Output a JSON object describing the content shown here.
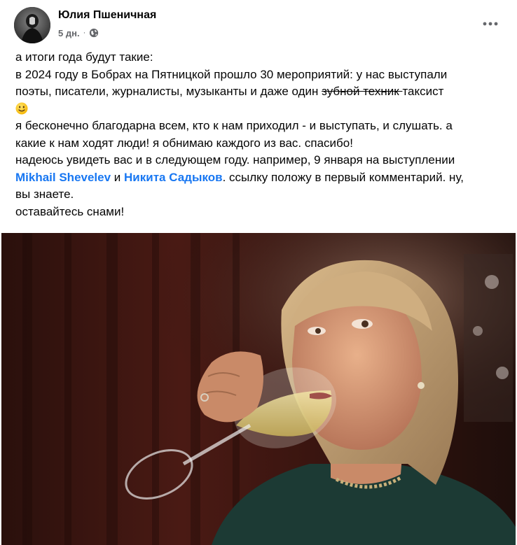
{
  "author": {
    "name": "Юлия Пшеничная"
  },
  "meta": {
    "time": "5 дн.",
    "separator": "·",
    "privacy_icon": "globe-icon"
  },
  "menu": {
    "icon": "more-horizontal-icon"
  },
  "post": {
    "line1": "а итоги года будут такие:",
    "line2": "в 2024 году в Бобрах на Пятницкой прошло 30 мероприятий: у нас выступали",
    "line3_before": "поэты, писатели, журналисты, музыканты и даже один ",
    "line3_struck": " зубной техник ",
    "line3_after": "таксист",
    "line4_emoji": "slightly-smiling-face-icon",
    "line5": "я бесконечно благодарна всем, кто к нам приходил - и выступать, и слушать. а",
    "line6": "какие к нам ходят люди! я обнимаю каждого из вас. спасибо!",
    "line7": "надеюсь увидеть вас и в следующем году. например, 9 января на выступлении",
    "line8_mention1": "Mikhail Shevelev",
    "line8_and": " и ",
    "line8_mention2": "Никита Садыков",
    "line8_after": ". ссылку положу в первый комментарий. ну,",
    "line9": "вы знаете.",
    "line10": "оставайтесь снами!"
  },
  "photo": {
    "subject": "photo-woman-drinking-wine"
  },
  "colors": {
    "link": "#1877f2",
    "secondary_text": "#65676b",
    "text": "#050505"
  }
}
